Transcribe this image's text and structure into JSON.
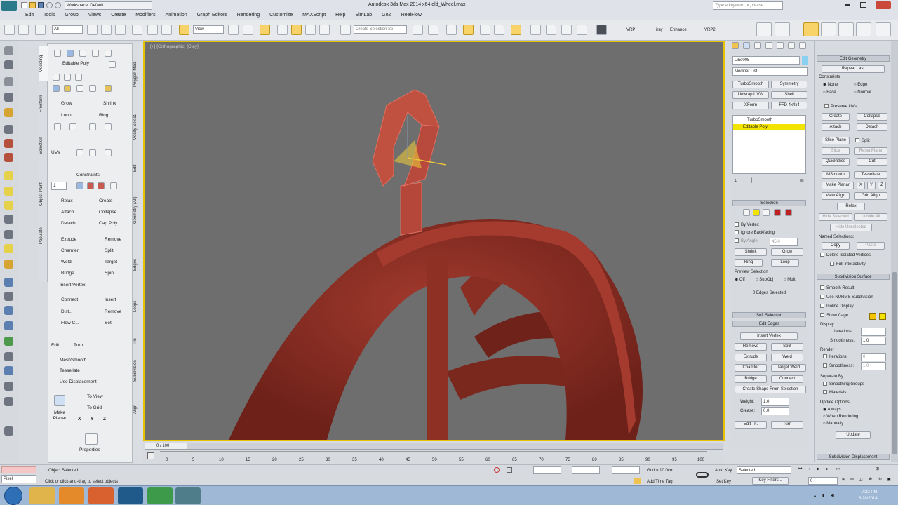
{
  "title_bar": {
    "workspace": "Workspace: Default",
    "title": "Autodesk 3ds Max  2014 x64    old_Wheel.max",
    "search_placeholder": "Type a keyword or phrase"
  },
  "menu": [
    "Edit",
    "Tools",
    "Group",
    "Views",
    "Create",
    "Modifiers",
    "Animation",
    "Graph Editors",
    "Rendering",
    "Customize",
    "MAXScript",
    "Help",
    "SimLab",
    "GoZ",
    "RealFlow"
  ],
  "toolbar": {
    "selection_filter": "All",
    "ref_coord": "View",
    "named_selection": "Create Selection Se",
    "vray_label": "VRP",
    "render_label": "iray",
    "enhance_label": "Enhance",
    "vray2_label": "VRP2"
  },
  "viewport": {
    "label": "[+] [Orthographic] [Clay]"
  },
  "ribbon": {
    "tabs": [
      "Modeling",
      "Freeform",
      "Selection",
      "Object Paint",
      "Populate"
    ],
    "side_tabs": [
      "Polygon Mod.",
      "Modify Select.",
      "Edit",
      "Geometry (All)",
      "Edges",
      "Loops",
      "Tris",
      "Subdivision",
      "Align"
    ],
    "editable_poly": "Editable Poly",
    "grow": "Grow",
    "shrink": "Shrink",
    "loop": "Loop",
    "ring": "Ring",
    "uvs": "UVs",
    "constraints": "Constraints",
    "relax": "Relax",
    "create": "Create",
    "attach": "Attach",
    "collapse": "Collapse",
    "detach": "Detach",
    "cap_poly": "Cap Poly",
    "extrude": "Extrude",
    "remove": "Remove",
    "chamfer": "Chamfer",
    "split": "Split",
    "weld": "Weld",
    "target": "Target",
    "bridge": "Bridge",
    "spin": "Spin",
    "insert_vertex": "Insert Vertex",
    "connect": "Connect",
    "insert": "Insert",
    "dist": "Dist...",
    "remove2": "Remove",
    "flow_c": "Flow C...",
    "set": "Set",
    "edit": "Edit",
    "turn": "Turn",
    "meshsmooth": "MeshSmooth",
    "tessellate": "Tessellate",
    "use_displacement": "Use Displacement",
    "make_planar": "Make Planar",
    "to_view": "To View",
    "to_grid": "To Grid",
    "x": "X",
    "y": "Y",
    "z": "Z",
    "properties": "Properties",
    "spinner_value": "1"
  },
  "command_panel": {
    "object_name": "Line005",
    "modifier_list": "Modifier List",
    "buttons": [
      "TurboSmooth",
      "Symmetry",
      "Unwrap UVW",
      "Shell",
      "XForm",
      "FFD 4x4x4"
    ],
    "stack": [
      "TurboSmooth",
      "Editable Poly"
    ],
    "selection_header": "Selection",
    "by_vertex": "By Vertex",
    "ignore_backfacing": "Ignore Backfacing",
    "by_angle": "By Angle:",
    "by_angle_value": "45.0",
    "shrink": "Shrink",
    "grow": "Grow",
    "ring": "Ring",
    "loop": "Loop",
    "preview_selection": "Preview Selection",
    "preview_opts": [
      "Off",
      "SubObj",
      "Multi"
    ],
    "edges_selected": "0 Edges Selected",
    "soft_selection": "Soft Selection",
    "edit_edges": "Edit Edges",
    "insert_vertex": "Insert Vertex",
    "remove": "Remove",
    "split": "Split",
    "extrude": "Extrude",
    "weld": "Weld",
    "chamfer": "Chamfer",
    "target_weld": "Target Weld",
    "bridge": "Bridge",
    "connect": "Connect",
    "create_shape": "Create Shape From Selection",
    "weight": "Weight:",
    "weight_value": "1.0",
    "crease": "Crease:",
    "crease_value": "0.0",
    "edit_tri": "Edit Tri.",
    "turn": "Turn"
  },
  "right_panel": {
    "edit_geometry": "Edit Geometry",
    "repeat_last": "Repeat Last",
    "constraints": "Constraints",
    "c_none": "None",
    "c_edge": "Edge",
    "c_face": "Face",
    "c_normal": "Normal",
    "preserve_uvs": "Preserve UVs",
    "create": "Create",
    "collapse": "Collapse",
    "attach": "Attach",
    "detach": "Detach",
    "slice_plane": "Slice Plane",
    "split": "Split",
    "slice": "Slice",
    "reset_plane": "Reset Plane",
    "quickslice": "QuickSlice",
    "cut": "Cut",
    "msmooth": "MSmooth",
    "tessellate": "Tessellate",
    "make_planar": "Make Planar",
    "x": "X",
    "y": "Y",
    "z": "Z",
    "view_align": "View Align",
    "grid_align": "Grid Align",
    "relax": "Relax",
    "hide_selected": "Hide Selected",
    "unhide_all": "Unhide All",
    "hide_unselected": "Hide Unselected",
    "named_selections": "Named Selections:",
    "copy": "Copy",
    "paste": "Paste",
    "delete_isolated": "Delete Isolated Vertices",
    "full_interactivity": "Full Interactivity",
    "subdivision_surface": "Subdivision Surface",
    "smooth_result": "Smooth Result",
    "use_nurms": "Use NURMS Subdivision",
    "isoline_display": "Isoline Display",
    "show_cage": "Show Cage......",
    "display": "Display",
    "iterations": "Iterations:",
    "iterations_value": "1",
    "smoothness": "Smoothness:",
    "smoothness_value": "1.0",
    "render": "Render",
    "r_iterations": "Iterations:",
    "r_iterations_value": "0",
    "r_smoothness": "Smoothness:",
    "r_smoothness_value": "1.0",
    "separate_by": "Separate By",
    "smoothing_groups": "Smoothing Groups",
    "materials": "Materials",
    "update_options": "Update Options",
    "always": "Always",
    "when_rendering": "When Rendering",
    "manually": "Manually",
    "update": "Update",
    "subdivision_displacement": "Subdivision Displacement"
  },
  "timeline": {
    "frame": "0 / 100",
    "ticks": [
      "0",
      "5",
      "10",
      "15",
      "20",
      "25",
      "30",
      "35",
      "40",
      "45",
      "50",
      "55",
      "60",
      "65",
      "70",
      "75",
      "80",
      "85",
      "90",
      "95",
      "100"
    ]
  },
  "status": {
    "script_label": "Pixel",
    "objects_selected": "1 Object Selected",
    "prompt": "Click or click-and-drag to select objects",
    "grid": "Grid = 10.0cm",
    "add_time_tag": "Add Time Tag",
    "auto_key": "Auto Key",
    "selected": "Selected",
    "set_key": "Set Key",
    "key_filters": "Key Filters...",
    "frame_value": "0",
    "clock_time": "7:22 PM",
    "clock_date": "6/28/2014"
  }
}
